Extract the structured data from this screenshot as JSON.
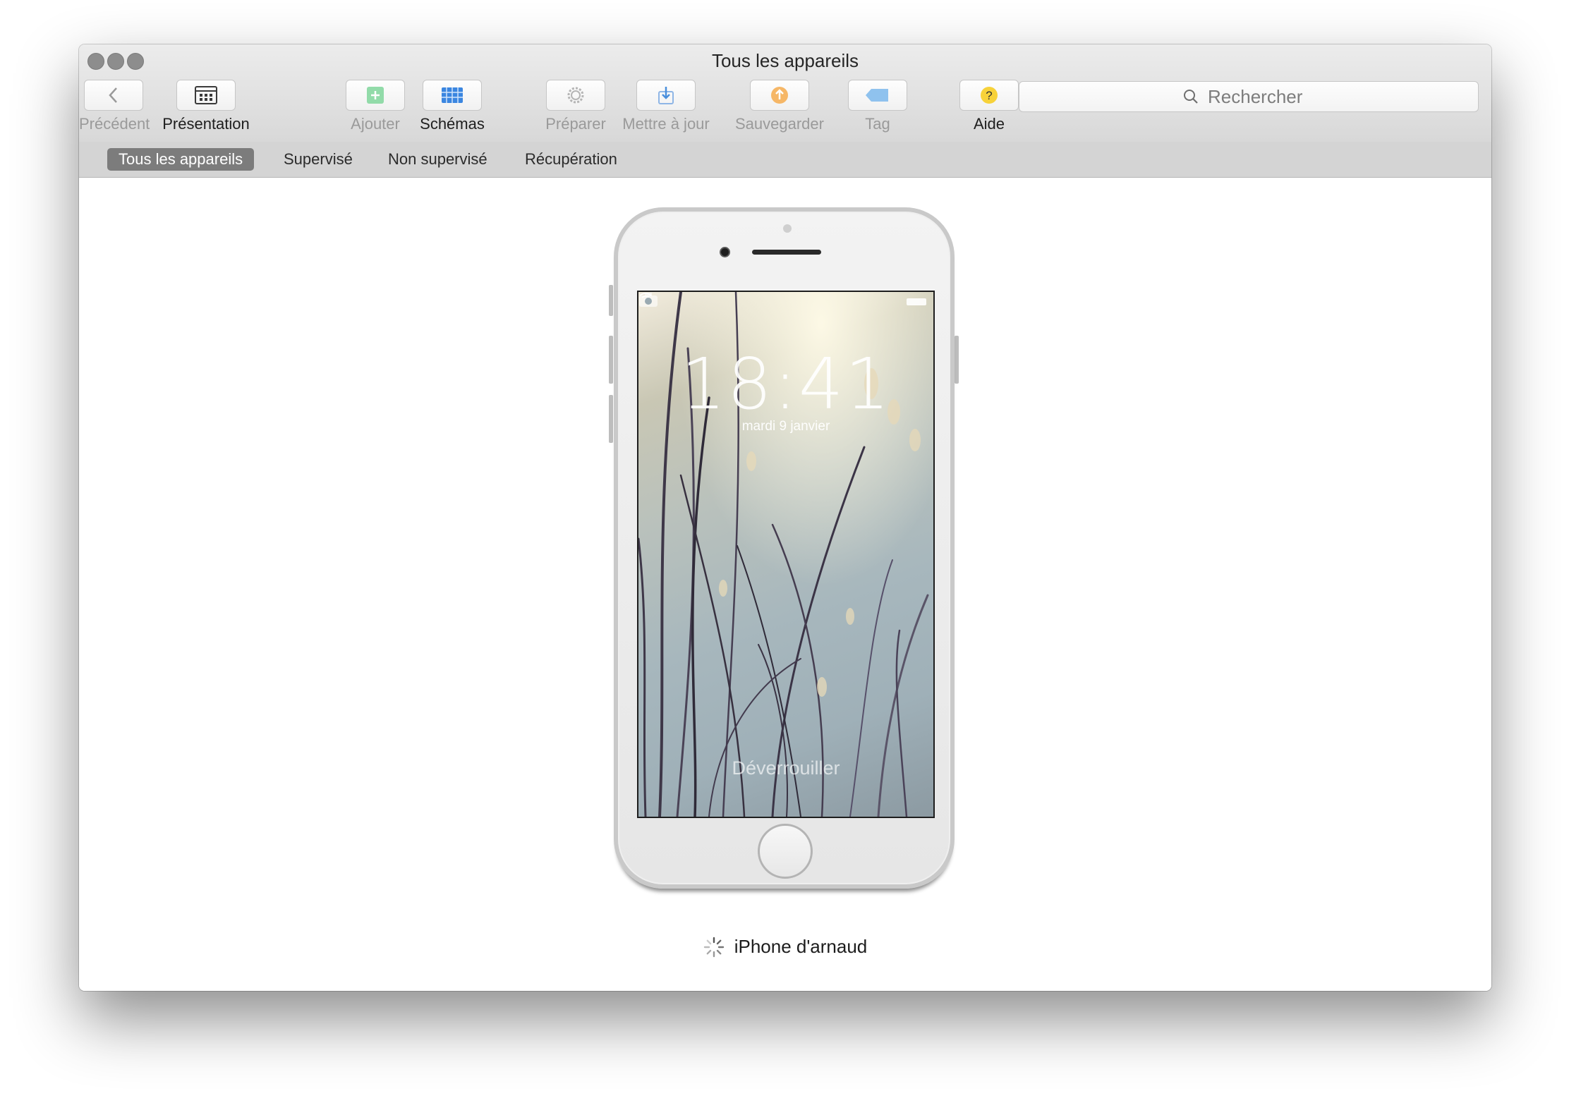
{
  "window": {
    "title": "Tous les appareils"
  },
  "toolbar": {
    "back": {
      "label": "Précédent",
      "icon": "chevron-left-icon"
    },
    "view": {
      "label": "Présentation",
      "icon": "view-grid-icon"
    },
    "add": {
      "label": "Ajouter",
      "icon": "plus-icon",
      "color": "#6ed18f"
    },
    "blueprints": {
      "label": "Schémas",
      "icon": "blueprints-icon",
      "color": "#3b86e0"
    },
    "prepare": {
      "label": "Préparer",
      "icon": "gear-icon"
    },
    "update": {
      "label": "Mettre à jour",
      "icon": "download-icon",
      "color": "#4a8fdc"
    },
    "backup": {
      "label": "Sauvegarder",
      "icon": "backup-arrow-icon",
      "color": "#f3a53a"
    },
    "tag": {
      "label": "Tag",
      "icon": "tag-icon",
      "color": "#7fb7e8"
    },
    "help": {
      "label": "Aide",
      "icon": "question-icon",
      "color": "#f7d23a"
    }
  },
  "search": {
    "placeholder": "Rechercher"
  },
  "scopes": [
    {
      "label": "Tous les appareils",
      "active": true
    },
    {
      "label": "Supervisé",
      "active": false
    },
    {
      "label": "Non supervisé",
      "active": false
    },
    {
      "label": "Récupération",
      "active": false
    }
  ],
  "device": {
    "name": "iPhone d'arnaud",
    "status_icon": "spinner-icon",
    "lock_screen": {
      "time": "18:41",
      "date": "mardi 9 janvier",
      "unlock_text": "Déverrouiller"
    }
  }
}
